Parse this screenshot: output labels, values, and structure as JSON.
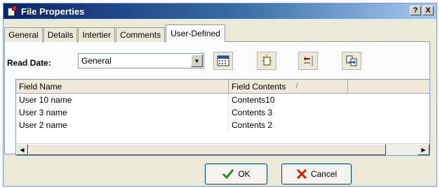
{
  "window": {
    "title": "File Properties",
    "help_label": "?",
    "close_label": "X"
  },
  "tabs": [
    {
      "label": "General"
    },
    {
      "label": "Details"
    },
    {
      "label": "Intertier"
    },
    {
      "label": "Comments"
    },
    {
      "label": "User-Defined",
      "active": true
    }
  ],
  "toolbar": {
    "read_date_label": "Read Date:",
    "read_date_value": "General",
    "buttons": [
      "calendar-icon",
      "new-field-icon",
      "delete-field-icon",
      "export-icon"
    ]
  },
  "grid": {
    "columns": [
      "Field Name",
      "Field Contents"
    ],
    "sort_indicator": "/",
    "rows": [
      {
        "name": "User 10 name",
        "contents": "Contents10"
      },
      {
        "name": "User 3 name",
        "contents": "Contents 3"
      },
      {
        "name": "User 2 name",
        "contents": "Contents 2"
      }
    ]
  },
  "buttons": {
    "ok_label": "OK",
    "cancel_label": "Cancel"
  },
  "colors": {
    "title_bar": "#0a246a",
    "ok_check": "#2e8b2e",
    "cancel_x": "#cc2200"
  }
}
